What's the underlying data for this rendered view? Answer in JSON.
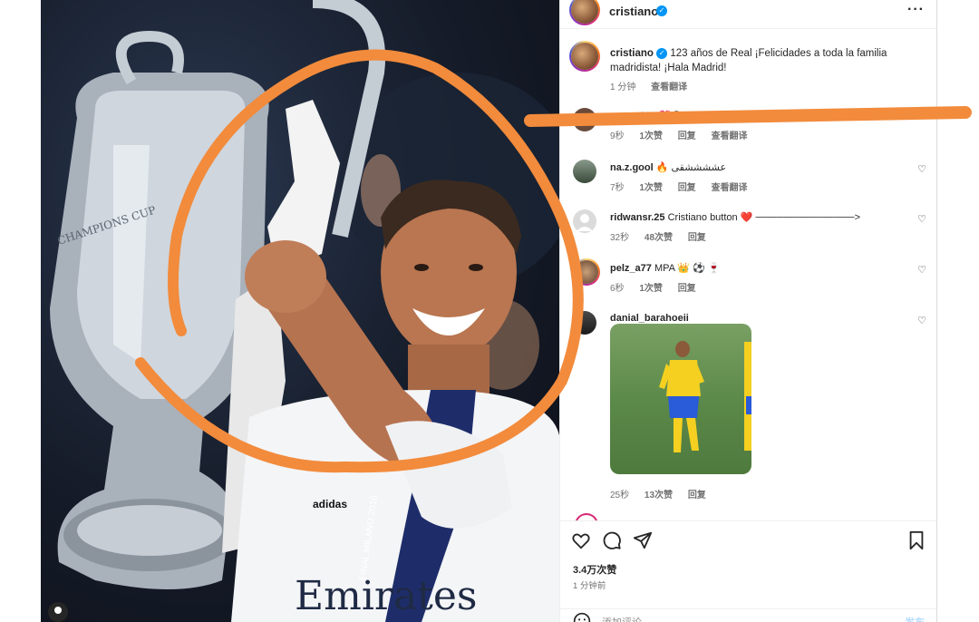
{
  "header": {
    "username": "cristiano",
    "verified_icon": "verified-badge-icon",
    "more_icon": "more-dots-icon"
  },
  "caption": {
    "username": "cristiano",
    "text": "123 años de Real ¡Felicidades a toda la familia madridista! ¡Hala Madrid!",
    "time": "1 分钟",
    "translate": "查看翻译"
  },
  "comments": [
    {
      "username": "oggy_696",
      "text": "💖😊 ...Kaoda...ral",
      "time": "9秒",
      "likes": "1次赞",
      "reply": "回复",
      "translate": "查看翻译"
    },
    {
      "username": "na.z.gool",
      "text": "🔥 عششششقی",
      "time": "7秒",
      "likes": "1次赞",
      "reply": "回复",
      "translate": "查看翻译"
    },
    {
      "username": "ridwansr.25",
      "text": "Cristiano button ❤️ ──────────────>",
      "time": "32秒",
      "likes": "48次赞",
      "reply": "回复"
    },
    {
      "username": "pelz_a77",
      "text": "MPA 👑 ⚽ 🍷",
      "time": "6秒",
      "likes": "1次赞",
      "reply": "回复"
    },
    {
      "username": "danial_barahoeii",
      "text": "",
      "time": "25秒",
      "likes": "13次赞",
      "reply": "回复"
    }
  ],
  "actions": {
    "likes": "3.4万次赞",
    "posted": "1 分钟前",
    "like_icon": "heart-icon",
    "comment_icon": "comment-icon",
    "share_icon": "paper-plane-icon",
    "save_icon": "bookmark-icon"
  },
  "add_comment": {
    "placeholder": "添加评论…",
    "post": "发布",
    "emoji_icon": "emoji-smile-icon"
  },
  "photo": {
    "jersey_text": "Emirates",
    "lanyard_text": "FINAL MILANO 2016",
    "trophy_text": "CHAMPIONS CUP"
  },
  "colors": {
    "annotation": "#f28b3c",
    "verified": "#0095f6",
    "link": "#0095f6",
    "muted": "#737373"
  }
}
